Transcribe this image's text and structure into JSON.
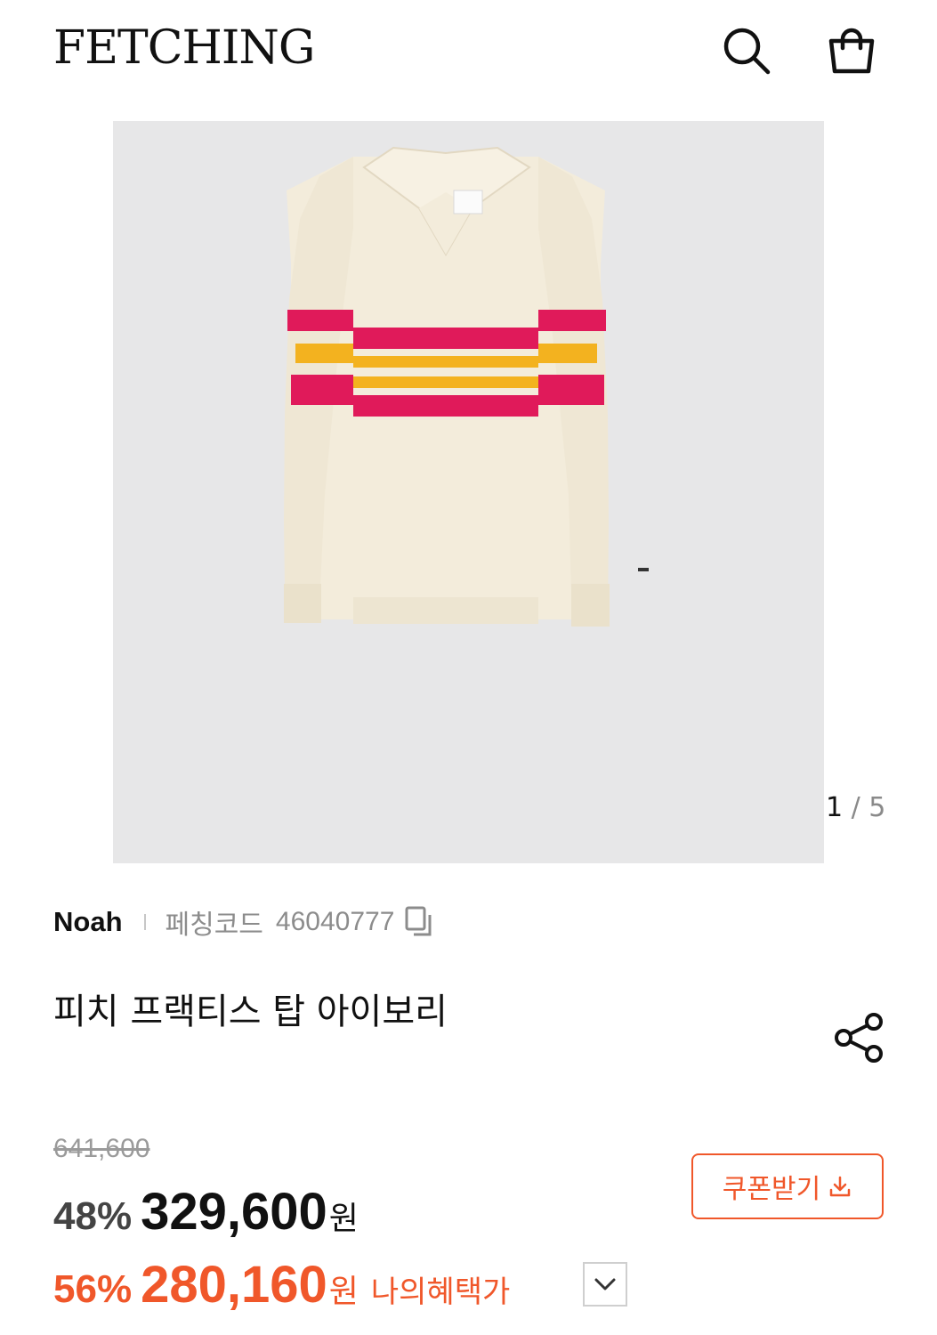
{
  "header": {
    "logo": "FETCHING",
    "search_icon": "search-icon",
    "bag_icon": "shopping-bag-icon"
  },
  "gallery": {
    "current": "1",
    "separator": " / ",
    "total": "5"
  },
  "product": {
    "brand": "Noah",
    "code_label": "페칭코드",
    "code": "46040777",
    "title": "피치 프랙티스 탑 아이보리"
  },
  "pricing": {
    "original_price": "641,600",
    "discount_percent": "48%",
    "sale_price": "329,600",
    "currency": "원",
    "benefit_percent": "56%",
    "benefit_price": "280,160",
    "benefit_label": "나의혜택가",
    "coupon_label": "쿠폰받기"
  },
  "colors": {
    "accent": "#f0572a",
    "stripe_pink": "#e01a5a",
    "stripe_yellow": "#f3b21f",
    "garment": "#f3ecdb",
    "image_bg": "#e7e7e8"
  }
}
